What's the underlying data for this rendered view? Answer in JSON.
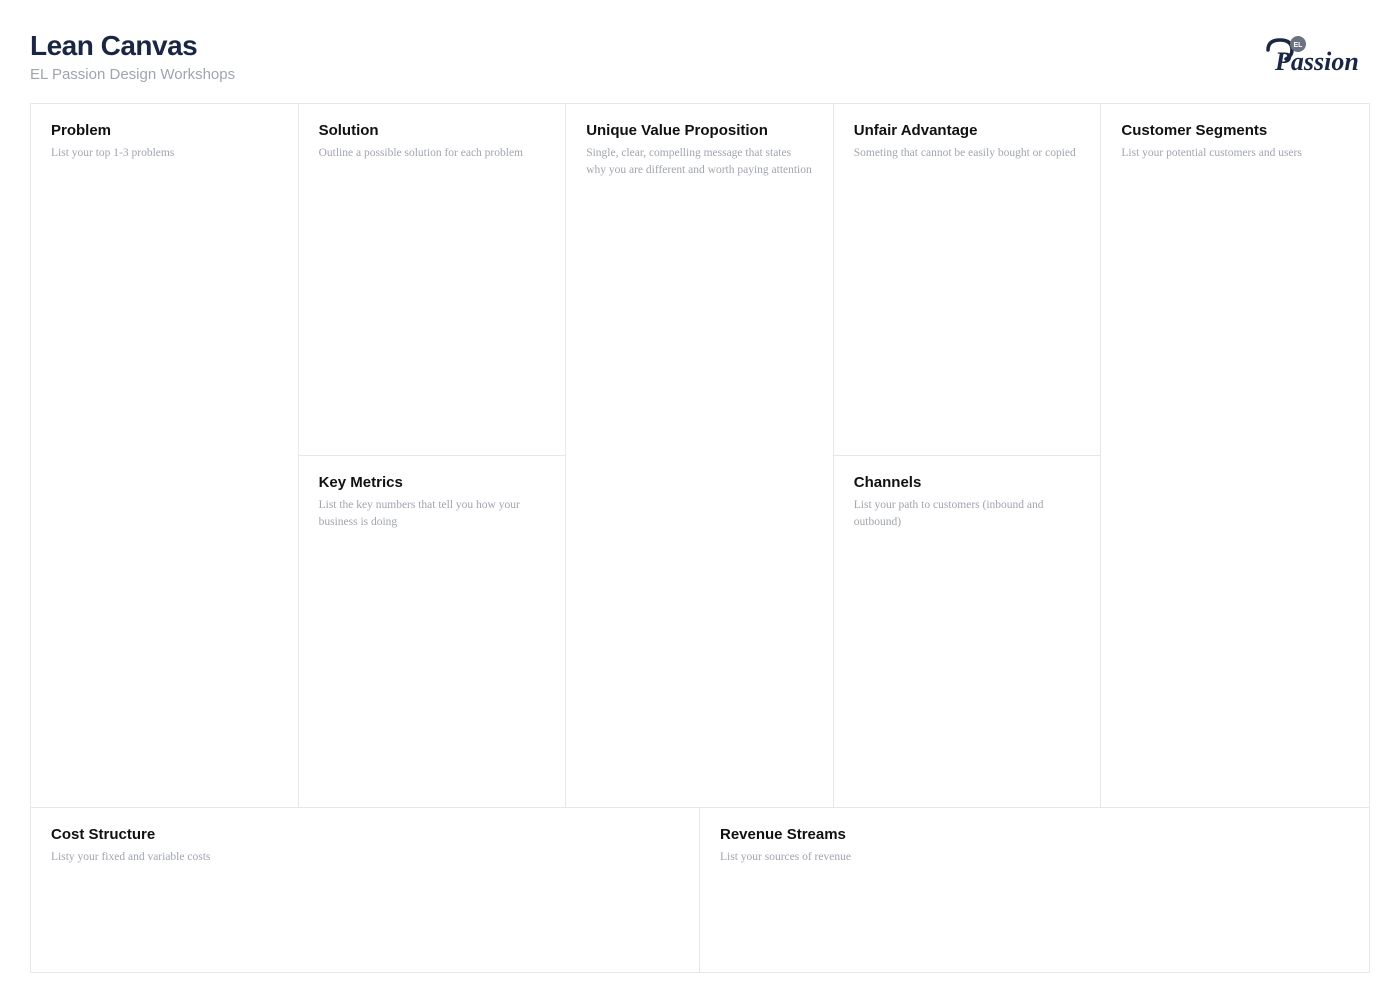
{
  "header": {
    "title": "Lean Canvas",
    "subtitle": "EL Passion Design Workshops"
  },
  "logo": {
    "alt": "EL Passion",
    "badge_text": "EL"
  },
  "cells": {
    "problem": {
      "title": "Problem",
      "desc": "List your top 1-3 problems"
    },
    "solution": {
      "title": "Solution",
      "desc": "Outline a possible solution for each problem"
    },
    "key_metrics": {
      "title": "Key Metrics",
      "desc": "List the key numbers that tell you how your business is doing"
    },
    "uvp": {
      "title": "Unique Value Proposition",
      "desc": "Single, clear, compelling message that states why you are different and worth paying attention"
    },
    "unfair_advantage": {
      "title": "Unfair Advantage",
      "desc": "Someting that cannot be easily bought or copied"
    },
    "channels": {
      "title": "Channels",
      "desc": "List your path to customers (inbound and outbound)"
    },
    "customer_segments": {
      "title": "Customer Segments",
      "desc": "List your potential customers and users"
    },
    "cost_structure": {
      "title": "Cost Structure",
      "desc": "Listy your fixed and variable costs"
    },
    "revenue_streams": {
      "title": "Revenue Streams",
      "desc": "List your sources of revenue"
    }
  }
}
